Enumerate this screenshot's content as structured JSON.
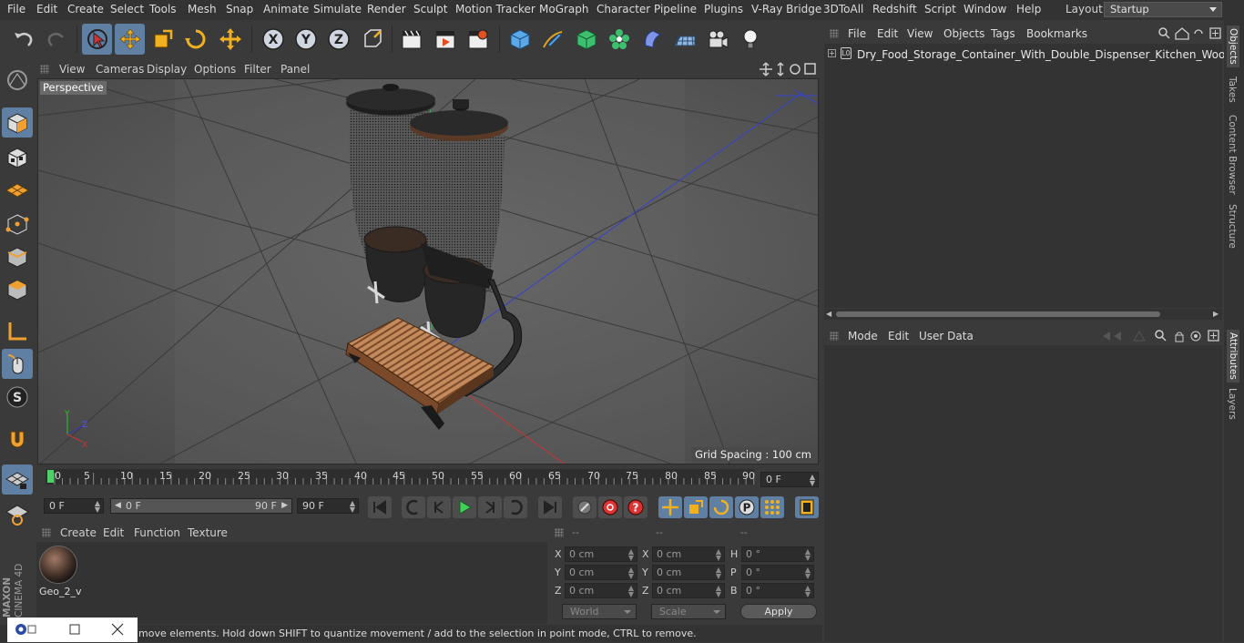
{
  "menu": [
    "File",
    "Edit",
    "Create",
    "Select",
    "Tools",
    "Mesh",
    "Snap",
    "Animate",
    "Simulate",
    "Render",
    "Sculpt",
    "Motion Tracker",
    "MoGraph",
    "Character",
    "Pipeline",
    "Plugins",
    "V-Ray Bridge",
    "3DToAll",
    "Redshift",
    "Script",
    "Window",
    "Help"
  ],
  "layout": {
    "label": "Layout:",
    "value": "Startup"
  },
  "viewport": {
    "menu": [
      "View",
      "Cameras",
      "Display",
      "Options",
      "Filter",
      "Panel"
    ],
    "label": "Perspective",
    "grid_spacing": "Grid Spacing : 100 cm"
  },
  "timeline": {
    "ticks": [
      "0",
      "5",
      "10",
      "15",
      "20",
      "25",
      "30",
      "35",
      "40",
      "45",
      "50",
      "55",
      "60",
      "65",
      "70",
      "75",
      "80",
      "85",
      "90"
    ],
    "current_frame": "0 F"
  },
  "anim": {
    "start": "0 F",
    "range_start": "0 F",
    "range_end": "90 F",
    "end": "90 F"
  },
  "material": {
    "menu": [
      "Create",
      "Edit",
      "Function",
      "Texture"
    ],
    "item": "Geo_2_v"
  },
  "coords": {
    "headers": [
      "--",
      "--",
      "--"
    ],
    "rows": [
      {
        "a": "X",
        "av": "0 cm",
        "b": "X",
        "bv": "0 cm",
        "c": "H",
        "cv": "0 °"
      },
      {
        "a": "Y",
        "av": "0 cm",
        "b": "Y",
        "bv": "0 cm",
        "c": "P",
        "cv": "0 °"
      },
      {
        "a": "Z",
        "av": "0 cm",
        "b": "Z",
        "bv": "0 cm",
        "c": "B",
        "cv": "0 °"
      }
    ],
    "space": "World",
    "mode": "Scale",
    "apply": "Apply"
  },
  "objects": {
    "menu": [
      "File",
      "Edit",
      "View",
      "Objects",
      "Tags",
      "Bookmarks"
    ],
    "item": "Dry_Food_Storage_Container_With_Double_Dispenser_Kitchen_Wooden_Base"
  },
  "attributes": {
    "menu": [
      "Mode",
      "Edit",
      "User Data"
    ]
  },
  "right_tabs": [
    "Objects",
    "Takes",
    "Content Browser",
    "Structure",
    "Attributes",
    "Layers"
  ],
  "status": "move elements. Hold down SHIFT to quantize movement / add to the selection in point mode, CTRL to remove.",
  "brand": "MAXON CINEMA 4D",
  "colors": {
    "accent": "#5f7fa3",
    "bg": "#3a3a3a",
    "viewport": "#515151",
    "wood": "#b5835a"
  }
}
